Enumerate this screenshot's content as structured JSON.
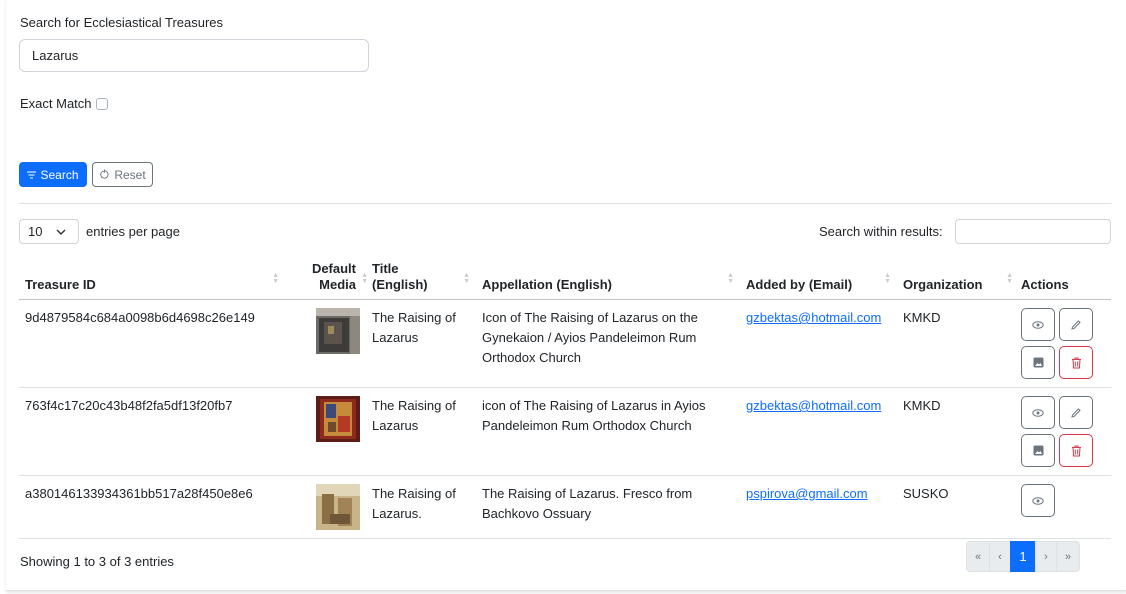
{
  "search": {
    "label": "Search for Ecclesiastical Treasures",
    "value": "Lazarus",
    "exact_match_label": "Exact Match",
    "exact_match_checked": false,
    "search_button": "Search",
    "reset_button": "Reset"
  },
  "table_controls": {
    "per_page_value": "10",
    "per_page_label": "entries per page",
    "within_label": "Search within results:",
    "within_value": ""
  },
  "table": {
    "headers": {
      "id": "Treasure ID",
      "media_line1": "Default",
      "media_line2": "Media",
      "title_line1": "Title",
      "title_line2": "(English)",
      "appellation": "Appellation (English)",
      "added_by": "Added by (Email)",
      "organization": "Organization",
      "actions": "Actions"
    },
    "rows": [
      {
        "id": "9d4879584c684a0098b6d4698c26e149",
        "title_line1": "The Raising of",
        "title_line2": "Lazarus",
        "appellation": "Icon of The Raising of Lazarus on the Gynekaion / Ayios Pandeleimon Rum Orthodox Church",
        "email": "gzbektas@hotmail.com",
        "organization": "KMKD"
      },
      {
        "id": "763f4c17c20c43b48f2fa5df13f20fb7",
        "title_line1": "The Raising of",
        "title_line2": "Lazarus",
        "appellation": "icon of The Raising of Lazarus in Ayios Pandeleimon Rum Orthodox Church",
        "email": "gzbektas@hotmail.com",
        "organization": "KMKD"
      },
      {
        "id": "a380146133934361bb517a28f450e8e6",
        "title_line1": "The Raising of",
        "title_line2": "Lazarus.",
        "appellation": "The Raising of Lazarus. Fresco from Bachkovo Ossuary",
        "email": "pspirova@gmail.com",
        "organization": "SUSKO"
      }
    ]
  },
  "footer": {
    "showing": "Showing 1 to 3 of 3 entries",
    "pagination": {
      "first": "«",
      "prev": "‹",
      "current": "1",
      "next": "›",
      "last": "»"
    }
  },
  "colors": {
    "primary": "#0d6efd",
    "danger": "#dc3545",
    "secondary": "#6c757d"
  }
}
